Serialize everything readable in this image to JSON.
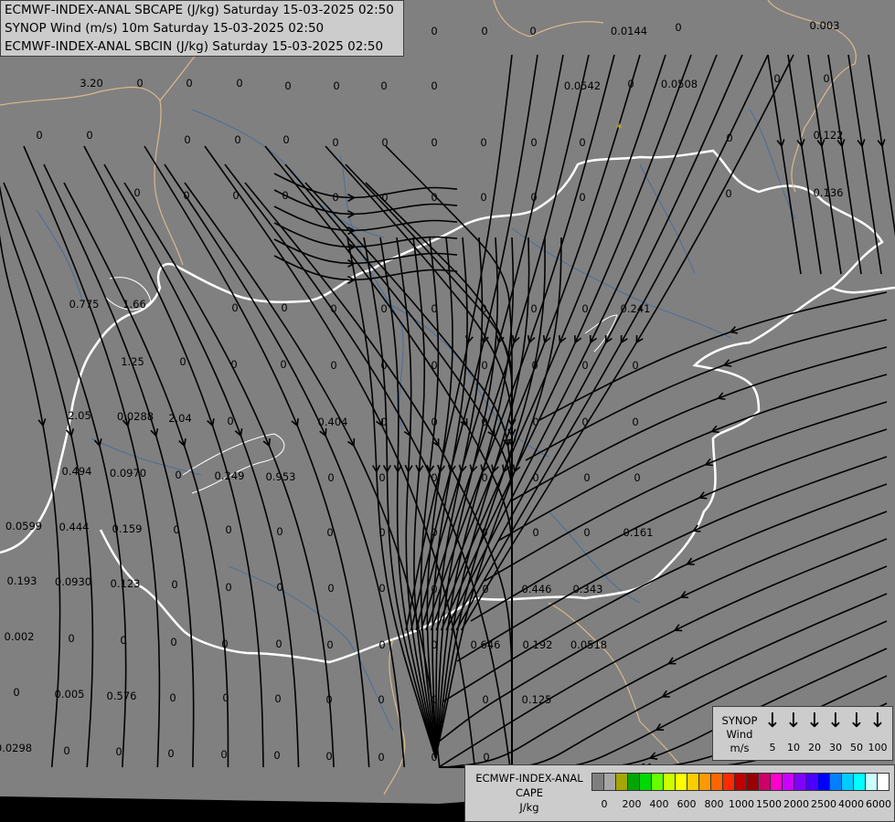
{
  "header": {
    "line1": "ECMWF-INDEX-ANAL SBCAPE (J/kg) Saturday 15-03-2025 02:50",
    "line2": "SYNOP Wind (m/s) 10m Saturday 15-03-2025 02:50",
    "line3": "ECMWF-INDEX-ANAL SBCIN (J/kg) Saturday 15-03-2025 02:50"
  },
  "map": {
    "background_color": "#808080",
    "streamline_color": "#000000",
    "border_color_inner": "#ffffff",
    "border_color_outer": "#d9b98c",
    "river_color": "#4a6e9a",
    "value_labels": [
      "0",
      "0",
      "0",
      "0",
      "0",
      "0",
      "0",
      "0.0144",
      "0",
      "0.003",
      "3.20",
      "0",
      "0",
      "0",
      "0",
      "0",
      "0",
      "0",
      "0.0542",
      "0",
      "0.0508",
      "0",
      "0",
      "0",
      "0",
      "0",
      "0",
      "0",
      "0",
      "0",
      "0",
      "0",
      "0",
      "0",
      "0",
      "0.122",
      "0",
      "0",
      "0",
      "0",
      "0",
      "0",
      "0",
      "0",
      "0",
      "0",
      "0",
      "0.136",
      "0.775",
      "1.66",
      "0",
      "0",
      "0",
      "0",
      "0",
      "0",
      "0",
      "0",
      "0.241",
      "1.25",
      "0",
      "0",
      "0",
      "0",
      "0",
      "0",
      "0",
      "0",
      "0",
      "0",
      "2.05",
      "0.0288",
      "2.04",
      "0",
      "0.404",
      "0",
      "0",
      "0",
      "0",
      "0",
      "0",
      "0.494",
      "0.0970",
      "0",
      "0.249",
      "0.953",
      "0",
      "0",
      "0",
      "0",
      "0",
      "0",
      "0",
      "0.0599",
      "0.444",
      "0.159",
      "0",
      "0",
      "0",
      "0",
      "0",
      "0",
      "0",
      "0",
      "0",
      "0.161",
      "0.193",
      "0.0930",
      "0.123",
      "0",
      "0",
      "0",
      "0",
      "0",
      "0",
      "0",
      "0.446",
      "0.343",
      "0.002",
      "0",
      "0",
      "0",
      "0",
      "0",
      "0",
      "0",
      "0",
      "0.646",
      "0.192",
      "0.0518",
      "0",
      "0.005",
      "0.576",
      "0",
      "0",
      "0",
      "0",
      "0",
      "0",
      "0",
      "0.125",
      "0.0298",
      "0",
      "0",
      "0",
      "0",
      "0",
      "0",
      "0",
      "0",
      "0",
      "0"
    ]
  },
  "synop_legend": {
    "label_line1": "SYNOP",
    "label_line2": "Wind",
    "label_line3": "m/s",
    "arrow_glyph": "↓",
    "speeds": [
      "5",
      "10",
      "20",
      "30",
      "50",
      "100"
    ]
  },
  "cape_legend": {
    "label_line1": "ECMWF-INDEX-ANAL",
    "label_line2": "CAPE",
    "label_line3": "J/kg",
    "colors": [
      "#7f7f7f",
      "#a6a6a6",
      "#a6a600",
      "#00a600",
      "#00d900",
      "#66ff00",
      "#ccff00",
      "#ffff00",
      "#ffcc00",
      "#ff9900",
      "#ff6600",
      "#ff2a00",
      "#c00000",
      "#990000",
      "#cc0066",
      "#ff00cc",
      "#cc00ff",
      "#8000ff",
      "#4b00ff",
      "#0000ff",
      "#0080ff",
      "#00ccff",
      "#00ffff",
      "#ccffff",
      "#ffffff"
    ],
    "ticks": [
      "0",
      "200",
      "400",
      "600",
      "800",
      "1000",
      "1500",
      "2000",
      "2500",
      "4000",
      "6000"
    ]
  }
}
